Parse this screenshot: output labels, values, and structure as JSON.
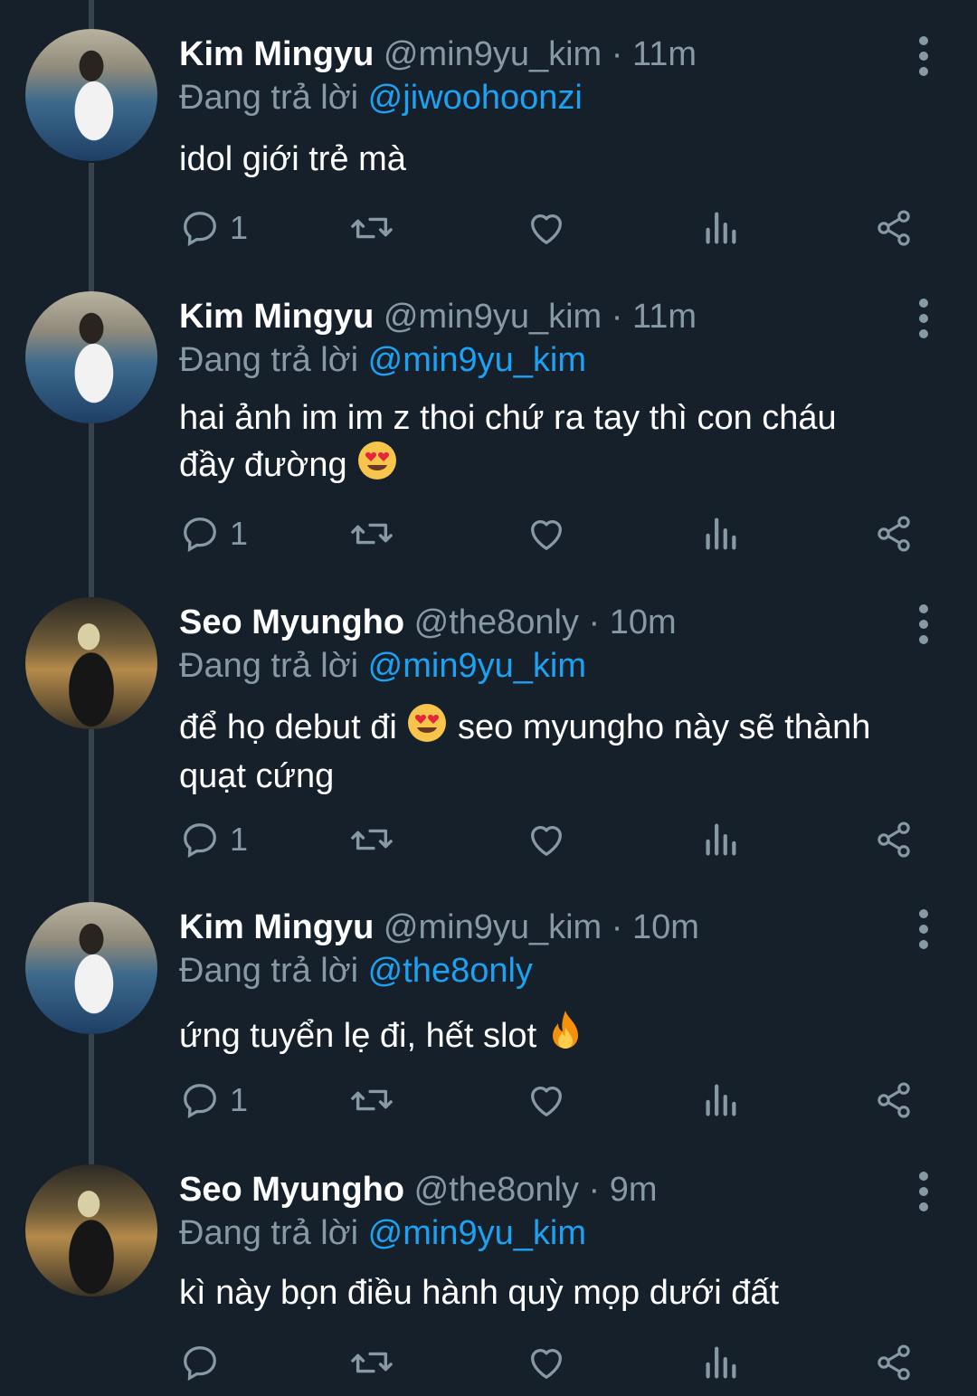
{
  "reply_prefix": "Đang trả lời",
  "colors": {
    "background": "#15202b",
    "secondary_text": "#8899a6",
    "mention": "#1da1f2",
    "thread_line": "#38444d"
  },
  "tweets": [
    {
      "name": "Kim Mingyu",
      "handle": "@min9yu_kim",
      "time": "· 11m",
      "reply_to": "@jiwoohoonzi",
      "text_lines": [
        "idol giới trẻ mà"
      ],
      "reply_count": "1",
      "avatar": "mingyu-avatar"
    },
    {
      "name": "Kim Mingyu",
      "handle": "@min9yu_kim",
      "time": "· 11m",
      "reply_to": "@min9yu_kim",
      "text_lines": [
        "hai ảnh im im z thoi chứ ra tay thì con cháu",
        "đầy đường"
      ],
      "emoji": "heart-eyes-emoji",
      "reply_count": "1",
      "avatar": "mingyu-avatar"
    },
    {
      "name": "Seo Myungho",
      "handle": "@the8only",
      "time": "· 10m",
      "reply_to": "@min9yu_kim",
      "text_a": "để họ debut đi",
      "text_b": "seo myungho này sẽ thành",
      "text_c": "quạt cứng",
      "emoji": "heart-eyes-emoji",
      "reply_count": "1",
      "avatar": "myungho-avatar"
    },
    {
      "name": "Kim Mingyu",
      "handle": "@min9yu_kim",
      "time": "· 10m",
      "reply_to": "@the8only",
      "text_lines": [
        "ứng tuyển lẹ đi, hết slot"
      ],
      "emoji": "fire-emoji",
      "reply_count": "1",
      "avatar": "mingyu-avatar"
    },
    {
      "name": "Seo Myungho",
      "handle": "@the8only",
      "time": "· 9m",
      "reply_to": "@min9yu_kim",
      "text_lines": [
        "kì này bọn điều hành quỳ mọp dưới đất"
      ],
      "reply_count": "",
      "avatar": "myungho-avatar"
    }
  ]
}
